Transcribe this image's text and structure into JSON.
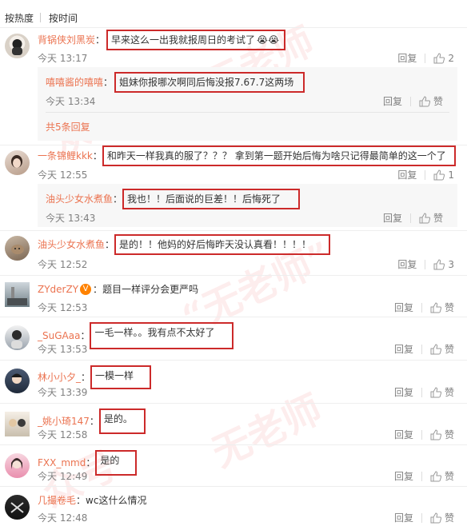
{
  "sort": {
    "hot": "按热度",
    "time": "按时间"
  },
  "reply_label": "回复",
  "like_label": "赞",
  "comments": [
    {
      "user": "背锅侠刘黑炭",
      "text": "早来这么一出我就报周日的考试了",
      "time": "今天 13:17",
      "likes": "2"
    },
    {
      "user": "一条锦鲤kkk",
      "text": "和昨天一样我真的服了？？？ 拿到第一题开始后悔为啥只记得最简单的这一个了",
      "time": "今天 12:55",
      "likes": "1"
    },
    {
      "user": "油头少女水煮鱼",
      "text": "是的！！他妈的好后悔昨天没认真看！！！！",
      "time": "今天 12:52",
      "likes": "3"
    },
    {
      "user": "ZYderZY",
      "text": "题目一样评分会更严吗",
      "time": "今天 12:53",
      "likes": "赞"
    },
    {
      "user": "_SuGAaa",
      "text": "一毛一样。。我有点不太好了",
      "time": "今天 13:53",
      "likes": "赞"
    },
    {
      "user": "林小小夕_",
      "text": "一模一样",
      "time": "今天 13:39",
      "likes": "赞"
    },
    {
      "user": "_姚小琦147",
      "text": "是的。",
      "time": "今天 12:58",
      "likes": "赞"
    },
    {
      "user": "FXX_mmd",
      "text": "是的",
      "time": "今天 12:49",
      "likes": "赞"
    },
    {
      "user": "几撮卷毛",
      "text": "wc这什么情况",
      "time": "今天 12:48",
      "likes": "赞"
    }
  ],
  "replies": [
    {
      "user": "嘻嘻酱的嘻嘻",
      "text": "姐妹你报哪次啊同后悔没报7.67.7这两场",
      "time": "今天 13:34",
      "likes": "赞"
    },
    {
      "user": "油头少女水煮鱼",
      "text": "我也！！后面说的巨差！！后悔死了",
      "time": "今天 13:43",
      "likes": "赞"
    }
  ],
  "more_replies": "共5条回复",
  "colors": {
    "username": "#eb7350",
    "highlight_box": "#cc2a2a",
    "reply_bg": "#f7f7f7"
  },
  "watermark": {
    "text1": "无老师",
    "text2": "众号",
    "text3": "“无老师”"
  }
}
